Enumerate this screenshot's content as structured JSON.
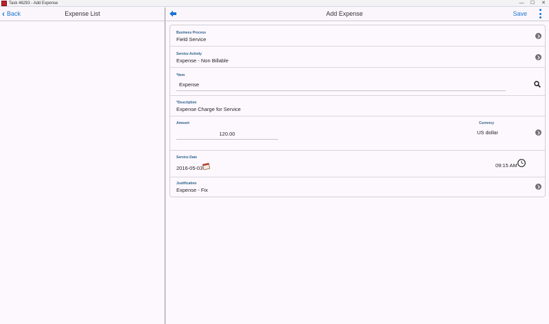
{
  "window": {
    "title": "Task 46293 - Add Expense",
    "minimize": "—",
    "maximize": "☐",
    "close": "✕"
  },
  "left": {
    "back_label": "Back",
    "title": "Expense List"
  },
  "right": {
    "title": "Add Expense",
    "save_label": "Save"
  },
  "form": {
    "business_process": {
      "label": "Business Process",
      "value": "Field Service"
    },
    "service_activity": {
      "label": "Service Activity",
      "value": "Expense - Non Billable"
    },
    "item": {
      "label": "*Item",
      "value": "Expense"
    },
    "description": {
      "label": "*Description",
      "value": "Expense Charge for Service"
    },
    "amount": {
      "label": "Amount",
      "value": "120.00"
    },
    "currency": {
      "label": "Currency",
      "value": "US dollar"
    },
    "service_date": {
      "label": "Service Date",
      "date": "2016-05-03",
      "time": "09:15 AM"
    },
    "justification": {
      "label": "Justification",
      "value": "Expense - Fix"
    }
  },
  "colors": {
    "accent": "#1a76d2",
    "label": "#2b5f8a",
    "background": "#fdf8fd"
  },
  "icons": [
    "back-chevron-icon",
    "back-arrow-icon",
    "more-vertical-icon",
    "chevron-right-icon",
    "search-icon",
    "calendar-icon",
    "clock-icon"
  ]
}
